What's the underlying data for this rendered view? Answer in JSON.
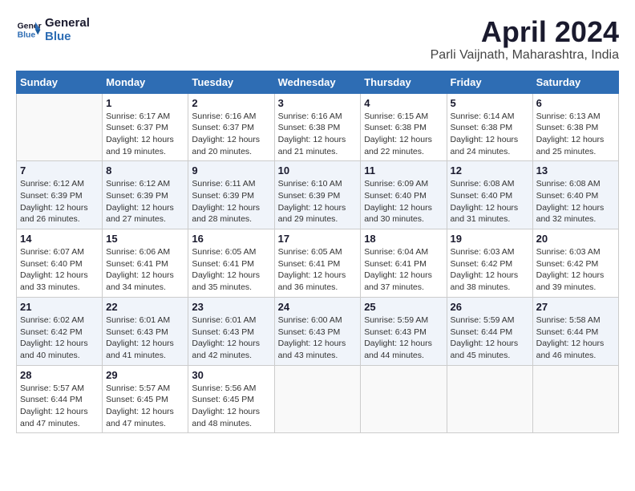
{
  "logo": {
    "line1": "General",
    "line2": "Blue"
  },
  "title": "April 2024",
  "location": "Parli Vaijnath, Maharashtra, India",
  "weekdays": [
    "Sunday",
    "Monday",
    "Tuesday",
    "Wednesday",
    "Thursday",
    "Friday",
    "Saturday"
  ],
  "weeks": [
    [
      {
        "day": "",
        "info": ""
      },
      {
        "day": "1",
        "info": "Sunrise: 6:17 AM\nSunset: 6:37 PM\nDaylight: 12 hours\nand 19 minutes."
      },
      {
        "day": "2",
        "info": "Sunrise: 6:16 AM\nSunset: 6:37 PM\nDaylight: 12 hours\nand 20 minutes."
      },
      {
        "day": "3",
        "info": "Sunrise: 6:16 AM\nSunset: 6:38 PM\nDaylight: 12 hours\nand 21 minutes."
      },
      {
        "day": "4",
        "info": "Sunrise: 6:15 AM\nSunset: 6:38 PM\nDaylight: 12 hours\nand 22 minutes."
      },
      {
        "day": "5",
        "info": "Sunrise: 6:14 AM\nSunset: 6:38 PM\nDaylight: 12 hours\nand 24 minutes."
      },
      {
        "day": "6",
        "info": "Sunrise: 6:13 AM\nSunset: 6:38 PM\nDaylight: 12 hours\nand 25 minutes."
      }
    ],
    [
      {
        "day": "7",
        "info": "Sunrise: 6:12 AM\nSunset: 6:39 PM\nDaylight: 12 hours\nand 26 minutes."
      },
      {
        "day": "8",
        "info": "Sunrise: 6:12 AM\nSunset: 6:39 PM\nDaylight: 12 hours\nand 27 minutes."
      },
      {
        "day": "9",
        "info": "Sunrise: 6:11 AM\nSunset: 6:39 PM\nDaylight: 12 hours\nand 28 minutes."
      },
      {
        "day": "10",
        "info": "Sunrise: 6:10 AM\nSunset: 6:39 PM\nDaylight: 12 hours\nand 29 minutes."
      },
      {
        "day": "11",
        "info": "Sunrise: 6:09 AM\nSunset: 6:40 PM\nDaylight: 12 hours\nand 30 minutes."
      },
      {
        "day": "12",
        "info": "Sunrise: 6:08 AM\nSunset: 6:40 PM\nDaylight: 12 hours\nand 31 minutes."
      },
      {
        "day": "13",
        "info": "Sunrise: 6:08 AM\nSunset: 6:40 PM\nDaylight: 12 hours\nand 32 minutes."
      }
    ],
    [
      {
        "day": "14",
        "info": "Sunrise: 6:07 AM\nSunset: 6:40 PM\nDaylight: 12 hours\nand 33 minutes."
      },
      {
        "day": "15",
        "info": "Sunrise: 6:06 AM\nSunset: 6:41 PM\nDaylight: 12 hours\nand 34 minutes."
      },
      {
        "day": "16",
        "info": "Sunrise: 6:05 AM\nSunset: 6:41 PM\nDaylight: 12 hours\nand 35 minutes."
      },
      {
        "day": "17",
        "info": "Sunrise: 6:05 AM\nSunset: 6:41 PM\nDaylight: 12 hours\nand 36 minutes."
      },
      {
        "day": "18",
        "info": "Sunrise: 6:04 AM\nSunset: 6:41 PM\nDaylight: 12 hours\nand 37 minutes."
      },
      {
        "day": "19",
        "info": "Sunrise: 6:03 AM\nSunset: 6:42 PM\nDaylight: 12 hours\nand 38 minutes."
      },
      {
        "day": "20",
        "info": "Sunrise: 6:03 AM\nSunset: 6:42 PM\nDaylight: 12 hours\nand 39 minutes."
      }
    ],
    [
      {
        "day": "21",
        "info": "Sunrise: 6:02 AM\nSunset: 6:42 PM\nDaylight: 12 hours\nand 40 minutes."
      },
      {
        "day": "22",
        "info": "Sunrise: 6:01 AM\nSunset: 6:43 PM\nDaylight: 12 hours\nand 41 minutes."
      },
      {
        "day": "23",
        "info": "Sunrise: 6:01 AM\nSunset: 6:43 PM\nDaylight: 12 hours\nand 42 minutes."
      },
      {
        "day": "24",
        "info": "Sunrise: 6:00 AM\nSunset: 6:43 PM\nDaylight: 12 hours\nand 43 minutes."
      },
      {
        "day": "25",
        "info": "Sunrise: 5:59 AM\nSunset: 6:43 PM\nDaylight: 12 hours\nand 44 minutes."
      },
      {
        "day": "26",
        "info": "Sunrise: 5:59 AM\nSunset: 6:44 PM\nDaylight: 12 hours\nand 45 minutes."
      },
      {
        "day": "27",
        "info": "Sunrise: 5:58 AM\nSunset: 6:44 PM\nDaylight: 12 hours\nand 46 minutes."
      }
    ],
    [
      {
        "day": "28",
        "info": "Sunrise: 5:57 AM\nSunset: 6:44 PM\nDaylight: 12 hours\nand 47 minutes."
      },
      {
        "day": "29",
        "info": "Sunrise: 5:57 AM\nSunset: 6:45 PM\nDaylight: 12 hours\nand 47 minutes."
      },
      {
        "day": "30",
        "info": "Sunrise: 5:56 AM\nSunset: 6:45 PM\nDaylight: 12 hours\nand 48 minutes."
      },
      {
        "day": "",
        "info": ""
      },
      {
        "day": "",
        "info": ""
      },
      {
        "day": "",
        "info": ""
      },
      {
        "day": "",
        "info": ""
      }
    ]
  ]
}
